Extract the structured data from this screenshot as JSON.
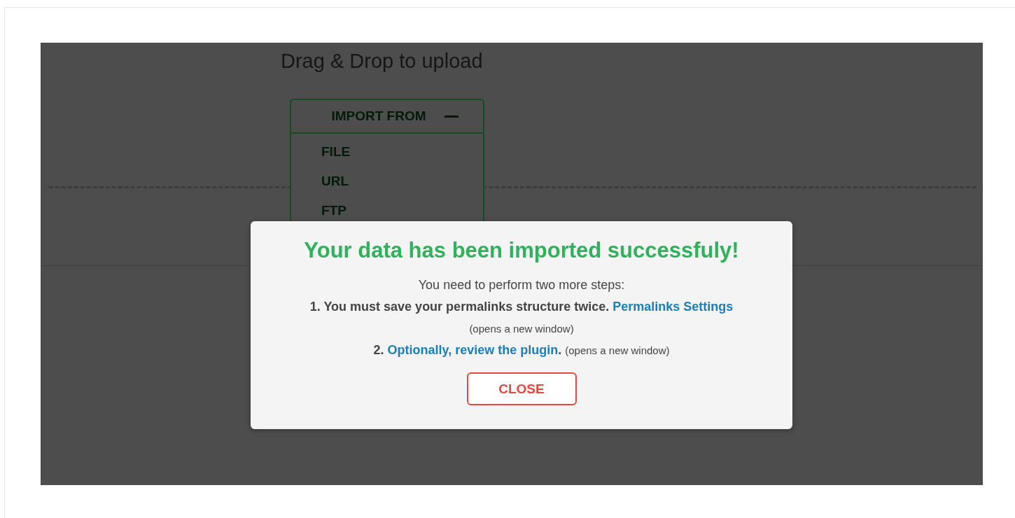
{
  "upload": {
    "heading": "Drag & Drop to upload",
    "import_menu": {
      "title": "IMPORT FROM",
      "expanded": true,
      "items": [
        "FILE",
        "URL",
        "FTP"
      ]
    }
  },
  "dialog": {
    "title": "Your data has been imported successfuly!",
    "intro": "You need to perform two more steps:",
    "steps": [
      {
        "number": "1.",
        "text": "You must save your permalinks structure twice.",
        "link": "Permalinks Settings",
        "note": "(opens a new window)"
      },
      {
        "number": "2.",
        "link": "Optionally, review the plugin",
        "after": ".",
        "note": "(opens a new window)"
      }
    ],
    "button": "CLOSE"
  }
}
